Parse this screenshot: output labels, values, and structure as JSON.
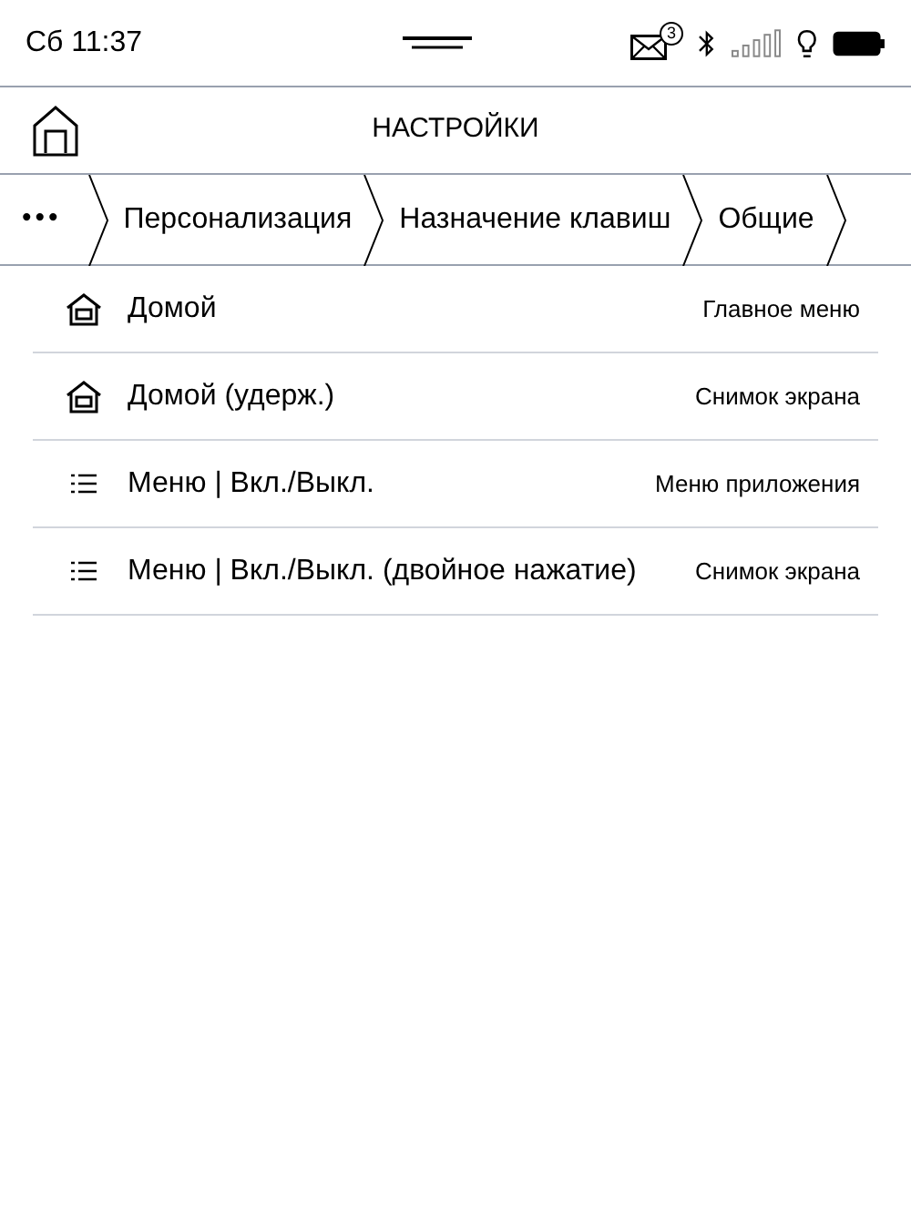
{
  "status_bar": {
    "time": "Сб 11:37",
    "mail_count": "3"
  },
  "header": {
    "title": "НАСТРОЙКИ"
  },
  "breadcrumb": [
    "•••",
    "Персонализация",
    "Назначение клавиш",
    "Общие"
  ],
  "rows": [
    {
      "kind": "home",
      "label": "Домой",
      "value": "Главное меню"
    },
    {
      "kind": "home",
      "label": "Домой (удерж.)",
      "value": "Снимок экрана"
    },
    {
      "kind": "menu",
      "label": "Меню | Вкл./Выкл.",
      "value": "Меню приложения"
    },
    {
      "kind": "menu",
      "label": "Меню | Вкл./Выкл. (двойное нажатие)",
      "value": "Снимок экрана"
    }
  ]
}
